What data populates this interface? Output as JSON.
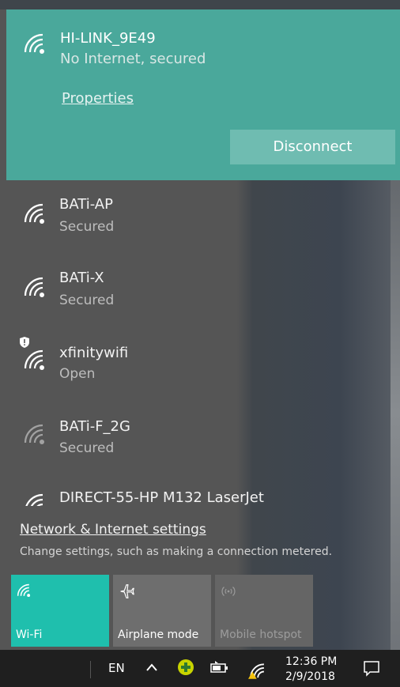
{
  "colors": {
    "accent": "#4aa89b",
    "tile_active": "#1fbfad",
    "taskbar": "#1f1f1f"
  },
  "connected": {
    "name": "HI-LINK_9E49",
    "status": "No Internet, secured",
    "properties_label": "Properties",
    "disconnect_label": "Disconnect"
  },
  "networks": [
    {
      "name": "BATi-AP",
      "status": "Secured"
    },
    {
      "name": "BATi-X",
      "status": "Secured"
    },
    {
      "name": "xfinitywifi",
      "status": "Open"
    },
    {
      "name": "BATi-F_2G",
      "status": "Secured"
    },
    {
      "name": "DIRECT-55-HP M132 LaserJet",
      "status": ""
    }
  ],
  "settings": {
    "link": "Network & Internet settings",
    "description": "Change settings, such as making a connection metered."
  },
  "tiles": [
    {
      "label": "Wi-Fi",
      "icon": "wifi-icon"
    },
    {
      "label": "Airplane mode",
      "icon": "airplane-icon"
    },
    {
      "label": "Mobile hotspot",
      "icon": "hotspot-icon"
    }
  ],
  "taskbar": {
    "language": "EN",
    "time": "12:36 PM",
    "date": "2/9/2018",
    "icons": [
      "chevron-up-icon",
      "plus-circle-icon",
      "battery-icon",
      "wifi-icon",
      "action-center-icon"
    ]
  }
}
